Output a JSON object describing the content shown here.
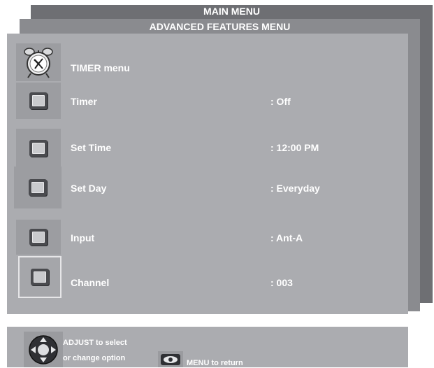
{
  "main_menu": {
    "title": "MAIN MENU"
  },
  "advanced_menu": {
    "title": "ADVANCED FEATURES MENU"
  },
  "timer_menu": {
    "title": "TIMER menu",
    "rows": [
      {
        "label": "Timer",
        "value": ": Off"
      },
      {
        "label": "Set Time",
        "value": ": 12:00 PM"
      },
      {
        "label": "Set Day",
        "value": ": Everyday"
      },
      {
        "label": "Input",
        "value": ": Ant-A"
      },
      {
        "label": "Channel",
        "value": ": 003"
      }
    ],
    "selected_row": "Channel"
  },
  "help": {
    "adjust_line1": "ADJUST to select",
    "adjust_line2": "or change option",
    "menu_text": "MENU  to  return"
  },
  "icons": {
    "timer": "alarm-clock-icon",
    "row": "square-button-icon",
    "adjust": "dpad-icon",
    "menu": "eye-button-icon"
  },
  "colors": {
    "main_panel": "#6e6f73",
    "advanced_panel": "#8a8b8f",
    "timer_panel": "#abacb0",
    "text": "#ffffff"
  }
}
